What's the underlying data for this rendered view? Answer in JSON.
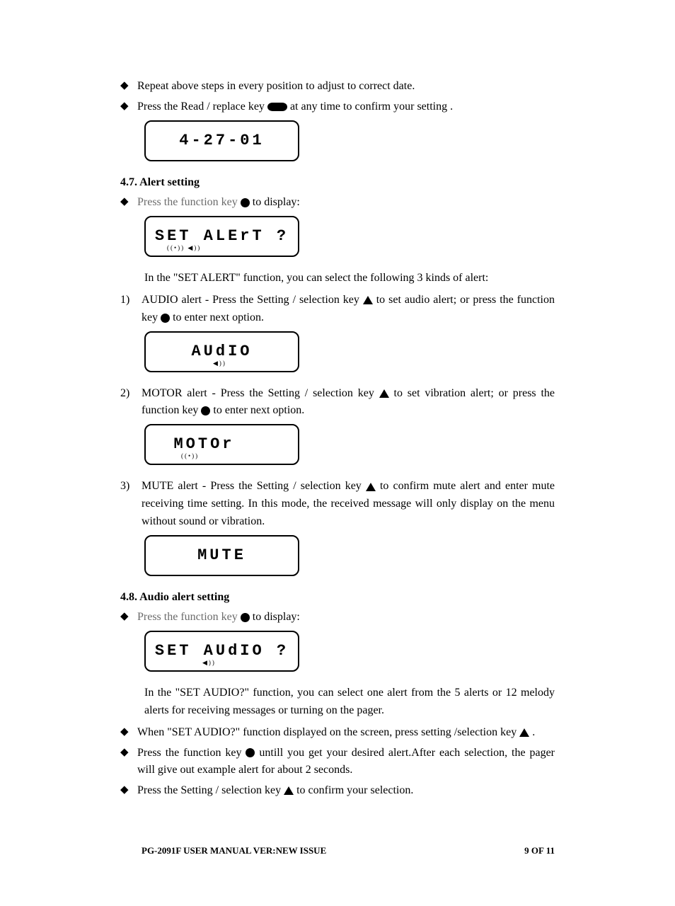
{
  "bullets_top": [
    "Repeat above steps in every position to adjust to correct date.",
    "Press the Read / replace key",
    " at any time to confirm your setting ."
  ],
  "lcd_date": "4-27-01",
  "sec47": {
    "heading": "4.7. Alert setting",
    "press_fn_a": "Press the function key ",
    "press_fn_b": " to display:",
    "lcd_set_alert": "SET  ALErT   ?",
    "lcd_set_alert_sub": "((•)) ◀))",
    "intro": "In the \"SET ALERT\" function, you can select the following 3 kinds of alert:",
    "audio_a": "AUDIO alert - Press the Setting / selection key ",
    "audio_b": " to set audio alert; or press the function key ",
    "audio_c": " to enter next option.",
    "lcd_audio": "AUdIO",
    "lcd_audio_sub": "◀))",
    "motor_a": "MOTOR alert - Press the Setting / selection key ",
    "motor_b": " to set vibration alert; or press the function key ",
    "motor_c": " to enter next option.",
    "lcd_motor": "MOTOr",
    "lcd_motor_sub": "((•))",
    "mute_a": "MUTE alert - Press the Setting / selection key ",
    "mute_b": " to confirm mute alert and enter mute receiving time setting. In this mode, the received message will only display on the menu without sound or vibration.",
    "lcd_mute": "MUTE"
  },
  "sec48": {
    "heading": "4.8. Audio alert setting",
    "press_fn_a": "Press the function key ",
    "press_fn_b": " to display:",
    "lcd_set_audio": "SET  AUdIO ?",
    "lcd_set_audio_sub": "◀))",
    "desc": "In the \"SET AUDIO?\" function, you can select one alert from the 5 alerts or 12 melody alerts for receiving messages or turning on the pager.",
    "b1_a": "When \"SET AUDIO?\" function displayed on the screen, press setting /selection key ",
    "b1_b": "  .",
    "b2_a": "Press the function key ",
    "b2_b": " untill you get your desired alert.After each selection, the pager will give out example alert for about 2 seconds.",
    "b3_a": "Press the Setting / selection key ",
    "b3_b": " to confirm your selection."
  },
  "footer": {
    "left": "PG-2091F    USER MANUAL    VER:NEW ISSUE",
    "right": "9   OF   11"
  }
}
